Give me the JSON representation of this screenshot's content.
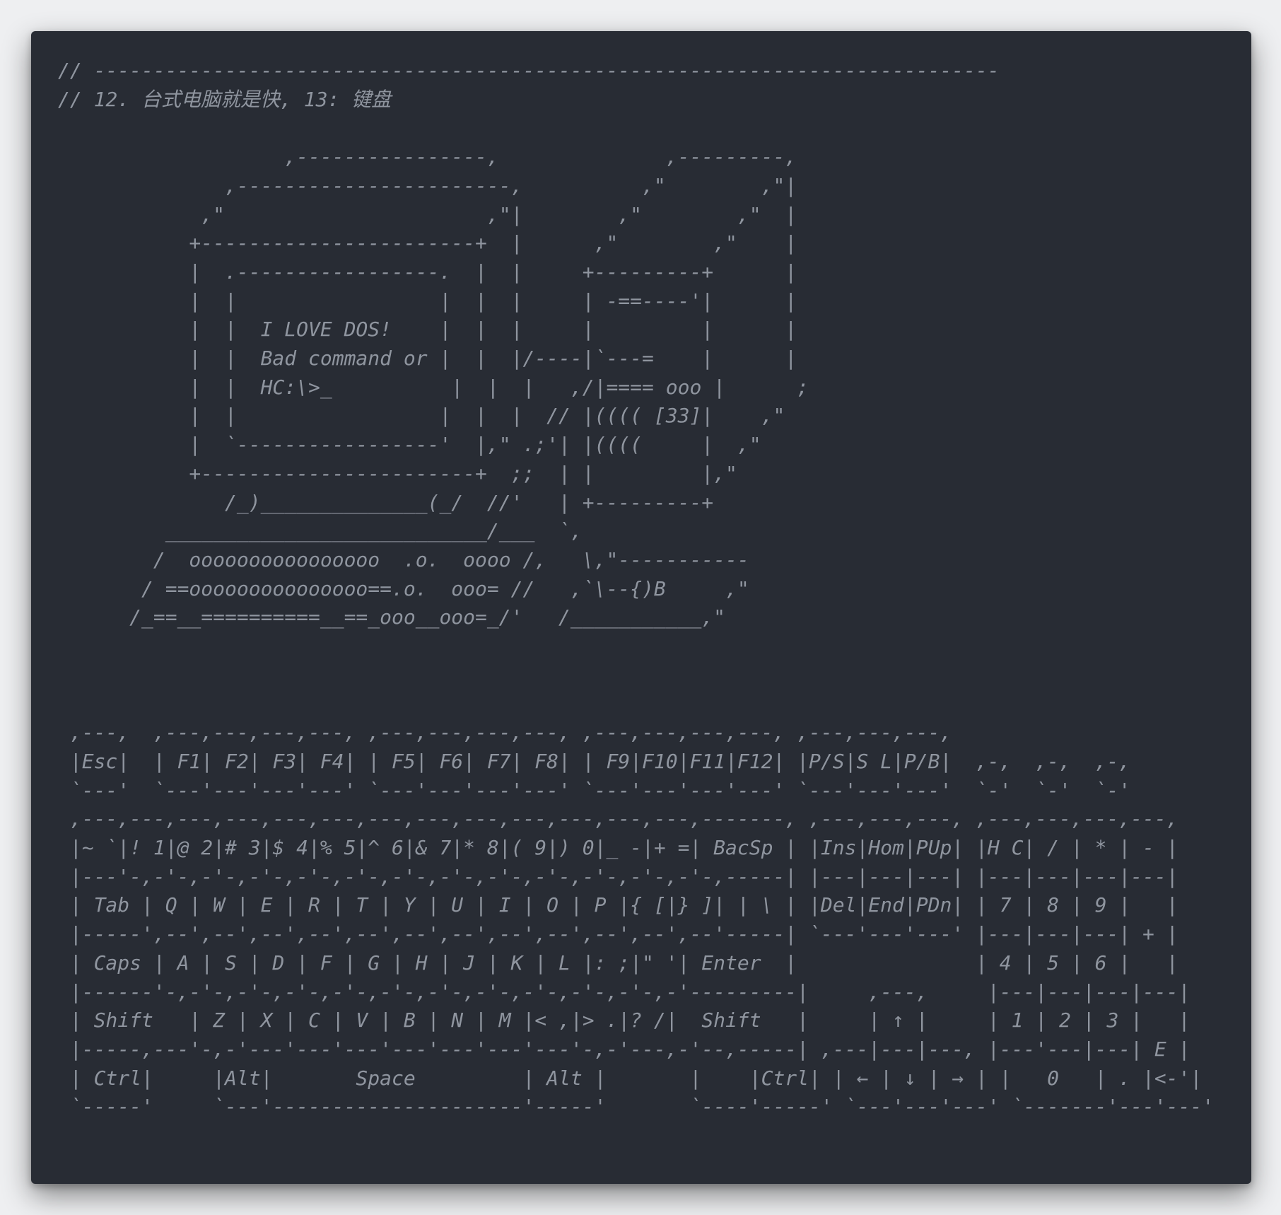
{
  "editor": {
    "code_text": "// ----------------------------------------------------------------------------\n// 12. 台式电脑就是快, 13: 键盘\n\n                   ,----------------,              ,---------,\n              ,-----------------------,          ,\"        ,\"|\n            ,\"                      ,\"|        ,\"        ,\"  |\n           +-----------------------+  |      ,\"        ,\"    |\n           |  .-----------------.  |  |     +---------+      |\n           |  |                 |  |  |     | -==----'|      |\n           |  |  I LOVE DOS!    |  |  |     |         |      |\n           |  |  Bad command or |  |  |/----|`---=    |      |\n           |  |  HC:\\>_          |  |  |   ,/|==== ooo |      ;\n           |  |                 |  |  |  // |(((( [33]|    ,\"\n           |  `-----------------'  |,\" .;'| |((((     |  ,\"\n           +-----------------------+  ;;  | |         |,\"\n              /_)______________(_/  //'   | +---------+\n         ___________________________/___  `,\n        /  oooooooooooooooo  .o.  oooo /,   \\,\"-----------\n       / ==ooooooooooooooo==.o.  ooo= //   ,`\\--{)B     ,\"\n      /_==__==========__==_ooo__ooo=_/'   /___________,\"\n\n\n\n ,---,  ,---,---,---,---, ,---,---,---,---, ,---,---,---,---, ,---,---,---,\n |Esc|  | F1| F2| F3| F4| | F5| F6| F7| F8| | F9|F10|F11|F12| |P/S|S L|P/B|  ,-,  ,-,  ,-,\n `---'  `---'---'---'---' `---'---'---'---' `---'---'---'---' `---'---'---'  `-'  `-'  `-'\n ,---,---,---,---,---,---,---,---,---,---,---,---,---,-------, ,---,---,---, ,---,---,---,---,\n |~ `|! 1|@ 2|# 3|$ 4|% 5|^ 6|& 7|* 8|( 9|) 0|_ -|+ =| BacSp | |Ins|Hom|PUp| |H C| / | * | - |\n |---'-,-'-,-'-,-'-,-'-,-'-,-'-,-'-,-'-,-'-,-'-,-'-,-'-,-----| |---|---|---| |---|---|---|---|\n | Tab | Q | W | E | R | T | Y | U | I | O | P |{ [|} ]| | \\ | |Del|End|PDn| | 7 | 8 | 9 |   |\n |-----',--',--',--',--',--',--',--',--',--',--',--',--'-----| `---'---'---' |---|---|---| + |\n | Caps | A | S | D | F | G | H | J | K | L |: ;|\" '| Enter  |               | 4 | 5 | 6 |   |\n |------'-,-'-,-'-,-'-,-'-,-'-,-'-,-'-,-'-,-'-,-'-,-'---------|     ,---,     |---|---|---|---|\n | Shift   | Z | X | C | V | B | N | M |< ,|> .|? /|  Shift   |     | ↑ |     | 1 | 2 | 3 |   |\n |-----,---'-,-'---'---'---'---'---'---'---'-,-'---,-'--,-----| ,---|---|---, |---'---|---| E |\n | Ctrl|     |Alt|       Space         | Alt |       |    |Ctrl| | ← | ↓ | → | |   0   | . |<-'|\n `-----'     `---'---------------------'-----'       `----'-----' `---'---'---' `-------'---'---'"
  }
}
